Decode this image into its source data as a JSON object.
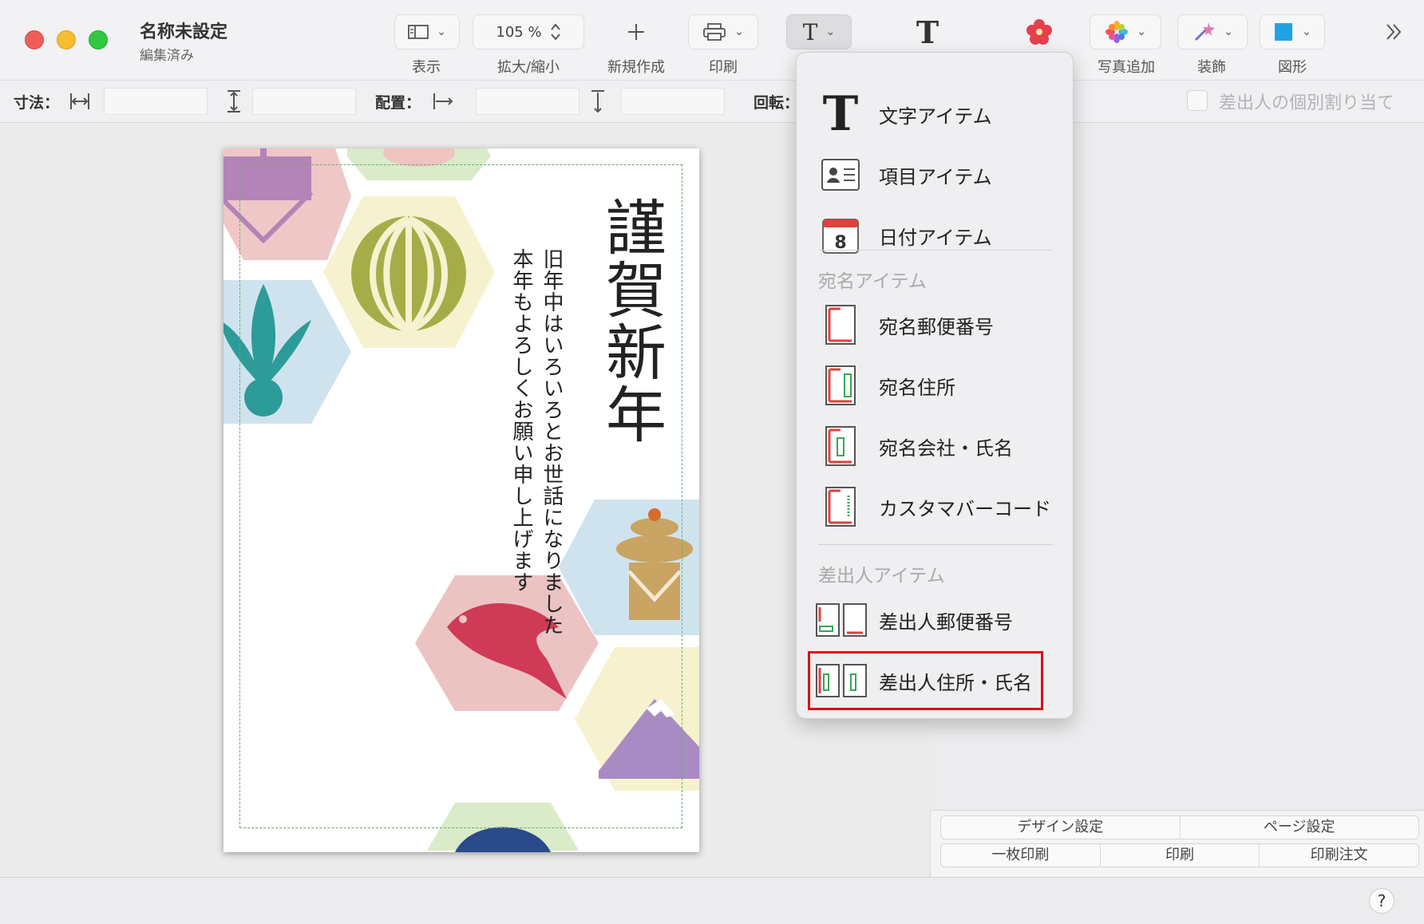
{
  "window": {
    "title": "名称未設定",
    "subtitle": "編集済み"
  },
  "toolbar": {
    "view_label": "表示",
    "zoom_value": "105 %",
    "zoom_label": "拡大/縮小",
    "new_label": "新規作成",
    "print_label": "印刷",
    "photo_label": "写真追加",
    "decor_label": "装飾",
    "shape_label": "図形"
  },
  "propbar": {
    "size_label": "寸法：",
    "align_label": "配置：",
    "rotate_label": "回転：",
    "sender_checkbox_label": "差出人の個別割り当て"
  },
  "card": {
    "title": "謹賀新年",
    "line1": "旧年中はいろいろとお世話になりました",
    "line2": "本年もよろしくお願い申し上げます"
  },
  "menu": {
    "items": [
      {
        "label": "文字アイテム",
        "icon": "text-T-icon"
      },
      {
        "label": "項目アイテム",
        "icon": "contact-card-icon"
      },
      {
        "label": "日付アイテム",
        "icon": "calendar-icon"
      }
    ],
    "address_section": "宛名アイテム",
    "address_items": [
      {
        "label": "宛名郵便番号",
        "icon": "postcode-icon"
      },
      {
        "label": "宛名住所",
        "icon": "address-icon"
      },
      {
        "label": "宛名会社・氏名",
        "icon": "company-name-icon"
      },
      {
        "label": "カスタマバーコード",
        "icon": "barcode-icon"
      }
    ],
    "sender_section": "差出人アイテム",
    "sender_items": [
      {
        "label": "差出人郵便番号",
        "icon": "sender-postcode-icon"
      },
      {
        "label": "差出人住所・氏名",
        "icon": "sender-address-icon",
        "highlighted": true
      }
    ],
    "calendar_day": "8"
  },
  "bottom_panel": {
    "design_settings": "デザイン設定",
    "page_settings": "ページ設定",
    "single_print": "一枚印刷",
    "print": "印刷",
    "print_order": "印刷注文"
  },
  "help_label": "?",
  "colors": {
    "accent_highlight": "#d8121d",
    "guide_line": "#6aab6a"
  }
}
